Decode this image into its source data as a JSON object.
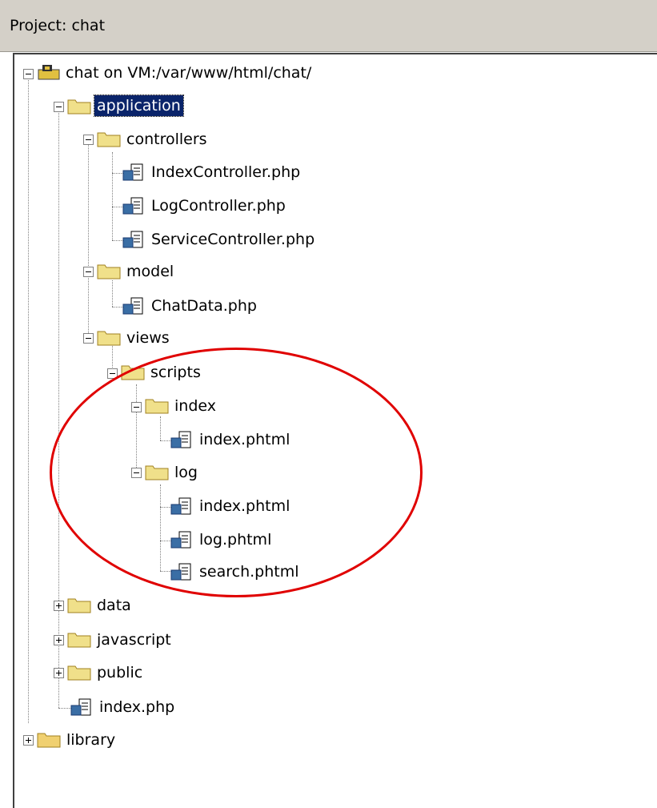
{
  "header": {
    "title": "Project: chat"
  },
  "tree": {
    "root": {
      "label": "chat on VM:/var/www/html/chat/",
      "icon": "project-icon"
    },
    "application": {
      "label": "application",
      "selected": true
    },
    "controllers": {
      "label": "controllers"
    },
    "files_controllers": [
      "IndexController.php",
      "LogController.php",
      "ServiceController.php"
    ],
    "model": {
      "label": "model"
    },
    "files_model": [
      "ChatData.php"
    ],
    "views": {
      "label": "views"
    },
    "scripts": {
      "label": "scripts"
    },
    "index_folder": {
      "label": "index"
    },
    "files_index": [
      "index.phtml"
    ],
    "log_folder": {
      "label": "log"
    },
    "files_log": [
      "index.phtml",
      "log.phtml",
      "search.phtml"
    ],
    "data": {
      "label": "data"
    },
    "javascript": {
      "label": "javascript"
    },
    "public": {
      "label": "public"
    },
    "files_root": [
      "index.php"
    ],
    "library": {
      "label": "library"
    }
  },
  "colors": {
    "selection": "#0a246a",
    "annotation_circle": "#e00000",
    "folder": "#f0e08a"
  }
}
